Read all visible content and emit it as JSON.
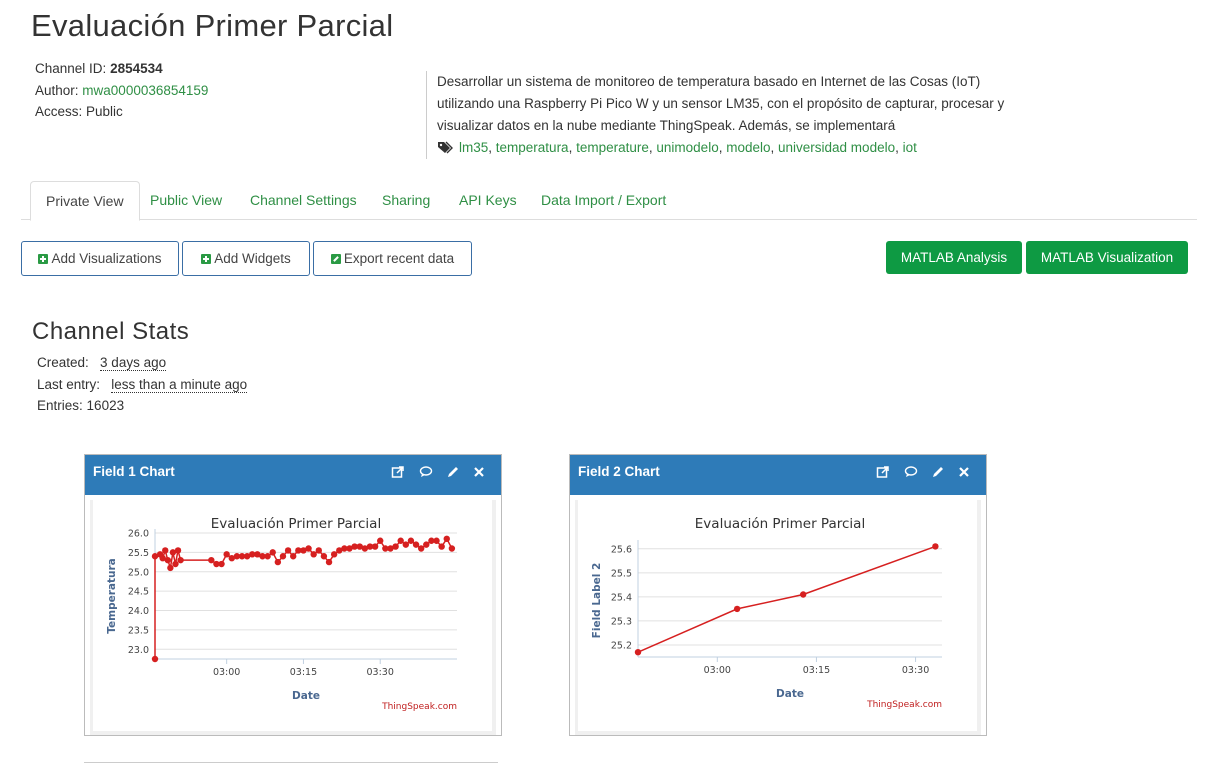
{
  "page": {
    "title": "Evaluación Primer Parcial"
  },
  "channel": {
    "id_label": "Channel ID:",
    "id_value": "2854534",
    "author_label": "Author:",
    "author_value": "mwa0000036854159",
    "access_label": "Access:",
    "access_value": "Public",
    "description_lines": [
      "Desarrollar un sistema de monitoreo de temperatura basado en Internet de las Cosas (IoT)",
      "utilizando una Raspberry Pi Pico W y un sensor LM35, con el propósito de capturar, procesar y",
      "visualizar datos en la nube mediante ThingSpeak. Además, se implementará"
    ],
    "tags": [
      "lm35",
      "temperatura",
      "temperature",
      "unimodelo",
      "modelo",
      "universidad modelo",
      "iot"
    ]
  },
  "tabs": [
    "Private View",
    "Public View",
    "Channel Settings",
    "Sharing",
    "API Keys",
    "Data Import / Export"
  ],
  "toolbar": {
    "add_visualizations": "Add Visualizations",
    "add_widgets": "Add Widgets",
    "export_recent": "Export recent data",
    "matlab_analysis": "MATLAB Analysis",
    "matlab_visualization": "MATLAB Visualization"
  },
  "stats": {
    "title": "Channel Stats",
    "created_label": "Created:",
    "created_value": "3 days ago",
    "last_entry_label": "Last entry:",
    "last_entry_value": "less than a minute ago",
    "entries_label": "Entries:",
    "entries_value": "16023"
  },
  "cards": [
    {
      "title": "Field 1 Chart"
    },
    {
      "title": "Field 2 Chart"
    }
  ],
  "icons": {
    "external": "external-link-icon",
    "comment": "comment-icon",
    "edit": "pencil-icon",
    "close": "close-icon",
    "tag": "tags-icon"
  },
  "colors": {
    "link_green": "#2f8f45",
    "header_blue": "#2e7bb8",
    "button_green": "#0e9a43",
    "series_red": "#d62020"
  },
  "chart_data": [
    {
      "type": "line",
      "title": "Evaluación Primer Parcial",
      "xlabel": "Date",
      "ylabel": "Temperatura",
      "credit": "ThingSpeak.com",
      "x_ticks": [
        "03:00",
        "03:15",
        "03:30"
      ],
      "y_ticks": [
        "23.0",
        "23.5",
        "24.0",
        "24.5",
        "25.0",
        "25.5",
        "26.0"
      ],
      "ylim": [
        22.75,
        26.0
      ],
      "xlim": [
        "02:46",
        "03:45"
      ],
      "series": [
        {
          "values": [
            [
              "02:46",
              22.75
            ],
            [
              "02:46",
              25.4
            ],
            [
              "02:47",
              25.45
            ],
            [
              "02:47.5",
              25.35
            ],
            [
              "02:48",
              25.55
            ],
            [
              "02:48.5",
              25.3
            ],
            [
              "02:49",
              25.1
            ],
            [
              "02:49.5",
              25.5
            ],
            [
              "02:50",
              25.2
            ],
            [
              "02:50.5",
              25.55
            ],
            [
              "02:51",
              25.3
            ],
            [
              "02:57",
              25.3
            ],
            [
              "02:58",
              25.2
            ],
            [
              "02:59",
              25.2
            ],
            [
              "03:00",
              25.45
            ],
            [
              "03:01",
              25.35
            ],
            [
              "03:02",
              25.4
            ],
            [
              "03:03",
              25.4
            ],
            [
              "03:04",
              25.4
            ],
            [
              "03:05",
              25.45
            ],
            [
              "03:06",
              25.45
            ],
            [
              "03:07",
              25.4
            ],
            [
              "03:08",
              25.4
            ],
            [
              "03:09",
              25.5
            ],
            [
              "03:10",
              25.25
            ],
            [
              "03:11",
              25.4
            ],
            [
              "03:12",
              25.55
            ],
            [
              "03:13",
              25.4
            ],
            [
              "03:14",
              25.55
            ],
            [
              "03:15",
              25.55
            ],
            [
              "03:16",
              25.6
            ],
            [
              "03:17",
              25.45
            ],
            [
              "03:18",
              25.55
            ],
            [
              "03:19",
              25.4
            ],
            [
              "03:20",
              25.25
            ],
            [
              "03:21",
              25.45
            ],
            [
              "03:22",
              25.55
            ],
            [
              "03:23",
              25.6
            ],
            [
              "03:24",
              25.6
            ],
            [
              "03:25",
              25.65
            ],
            [
              "03:26",
              25.65
            ],
            [
              "03:27",
              25.6
            ],
            [
              "03:28",
              25.65
            ],
            [
              "03:29",
              25.65
            ],
            [
              "03:30",
              25.8
            ],
            [
              "03:31",
              25.6
            ],
            [
              "03:32",
              25.6
            ],
            [
              "03:33",
              25.65
            ],
            [
              "03:34",
              25.8
            ],
            [
              "03:35",
              25.7
            ],
            [
              "03:36",
              25.8
            ],
            [
              "03:37",
              25.7
            ],
            [
              "03:38",
              25.6
            ],
            [
              "03:39",
              25.7
            ],
            [
              "03:40",
              25.8
            ],
            [
              "03:41",
              25.8
            ],
            [
              "03:42",
              25.65
            ],
            [
              "03:43",
              25.85
            ],
            [
              "03:44",
              25.6
            ]
          ]
        }
      ]
    },
    {
      "type": "line",
      "title": "Evaluación Primer Parcial",
      "xlabel": "Date",
      "ylabel": "Field Label 2",
      "credit": "ThingSpeak.com",
      "x_ticks": [
        "03:00",
        "03:15",
        "03:30"
      ],
      "y_ticks": [
        "25.2",
        "25.3",
        "25.4",
        "25.5",
        "25.6"
      ],
      "ylim": [
        25.15,
        25.62
      ],
      "xlim": [
        "02:48",
        "03:34"
      ],
      "series": [
        {
          "values": [
            [
              "02:48",
              25.17
            ],
            [
              "03:03",
              25.35
            ],
            [
              "03:13",
              25.41
            ],
            [
              "03:33",
              25.61
            ]
          ]
        }
      ]
    }
  ]
}
